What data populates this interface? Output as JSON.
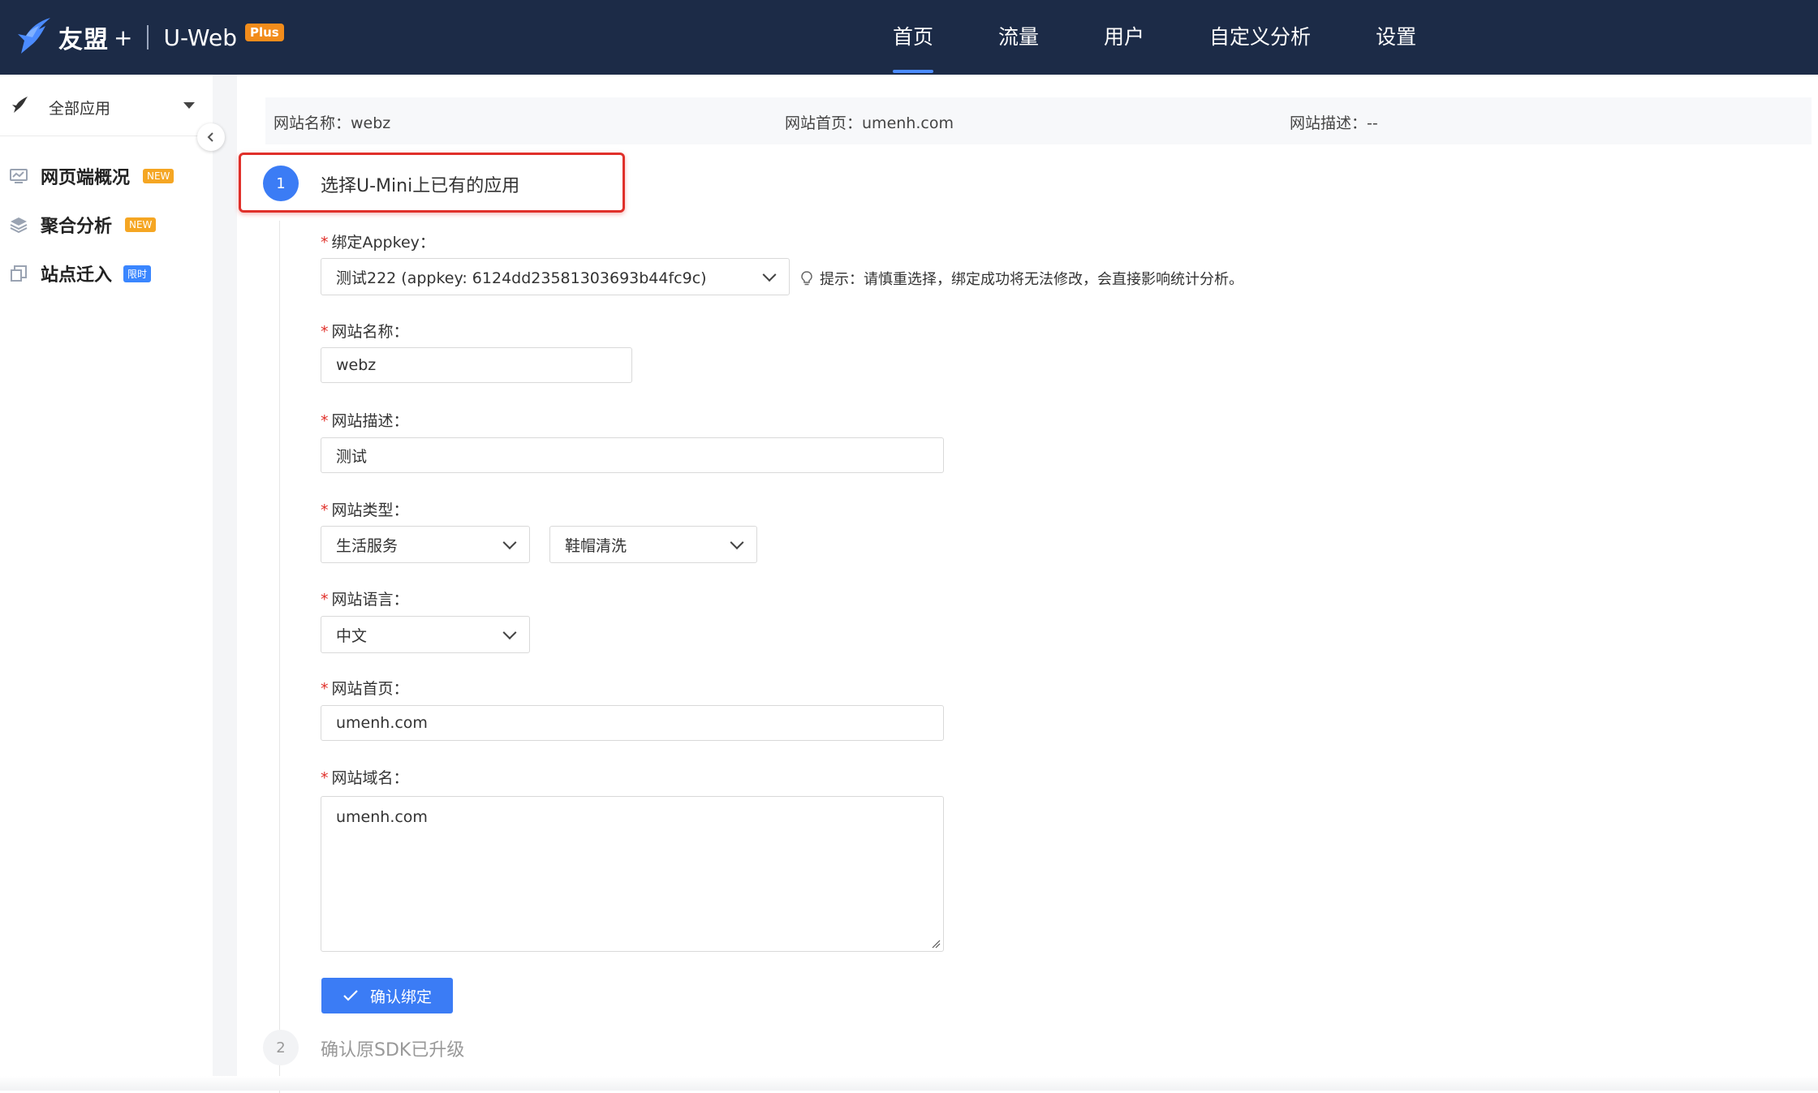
{
  "header": {
    "brand_name": "友盟",
    "brand_plus": "+",
    "product": "U-Web",
    "product_badge": "Plus",
    "nav": [
      {
        "label": "首页",
        "active": true
      },
      {
        "label": "流量",
        "active": false
      },
      {
        "label": "用户",
        "active": false
      },
      {
        "label": "自定义分析",
        "active": false
      },
      {
        "label": "设置",
        "active": false
      }
    ]
  },
  "sidebar": {
    "app_selector": {
      "label": "全部应用",
      "icon": "bird-icon"
    },
    "items": [
      {
        "label": "网页端概况",
        "badge": "NEW",
        "badge_color": "#f5a623",
        "icon": "monitor-chart-icon"
      },
      {
        "label": "聚合分析",
        "badge": "NEW",
        "badge_color": "#f5a623",
        "icon": "layers-icon"
      },
      {
        "label": "站点迁入",
        "badge": "限时",
        "badge_color": "#3a86ff",
        "icon": "copy-icon"
      }
    ]
  },
  "info_bar": {
    "name_label": "网站名称：",
    "name_value": "webz",
    "home_label": "网站首页：",
    "home_value": "umenh.com",
    "desc_label": "网站描述：",
    "desc_value": "--"
  },
  "steps": [
    {
      "number": "1",
      "title": "选择U-Mini上已有的应用",
      "active": true
    },
    {
      "number": "2",
      "title": "确认原SDK已升级",
      "active": false
    }
  ],
  "form": {
    "appkey_label": "绑定Appkey：",
    "appkey_value": "测试222 (appkey: 6124dd23581303693b44fc9c)",
    "hint": "提示：请慎重选择，绑定成功将无法修改，会直接影响统计分析。",
    "site_name_label": "网站名称：",
    "site_name_value": "webz",
    "site_desc_label": "网站描述：",
    "site_desc_value": "测试",
    "site_type_label": "网站类型：",
    "site_type_primary": "生活服务",
    "site_type_secondary": "鞋帽清洗",
    "site_lang_label": "网站语言：",
    "site_lang_value": "中文",
    "site_home_label": "网站首页：",
    "site_home_value": "umenh.com",
    "site_domain_label": "网站域名：",
    "site_domain_value": "umenh.com",
    "required_mark": "*",
    "confirm_label": "确认绑定"
  },
  "colors": {
    "topbar": "#1c2b47",
    "accent": "#3b7cf5",
    "highlight": "#e0302a"
  }
}
